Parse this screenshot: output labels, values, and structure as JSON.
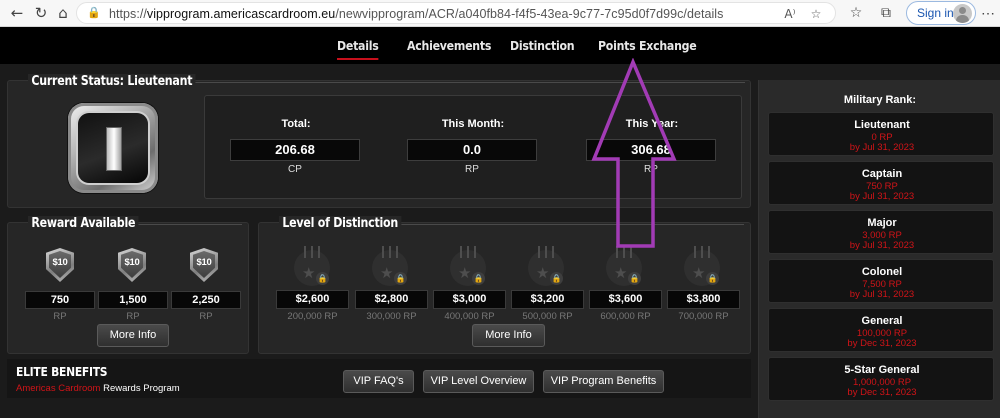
{
  "browser": {
    "url_prefix": "https://",
    "url_host": "vipprogram.americascardroom.eu",
    "url_path": "/newvipprogram/ACR/a040fb84-f4f5-43ea-9c77-7c95d0f7d99c/details",
    "signin_label": "Sign in",
    "icons": [
      "back-icon",
      "refresh-icon",
      "home-icon",
      "lock-icon",
      "read-aloud-icon",
      "favorite-icon",
      "favorites-bar-icon",
      "collections-icon",
      "profile-icon",
      "more-icon"
    ]
  },
  "nav": {
    "tabs": [
      {
        "label": "Details",
        "active": true
      },
      {
        "label": "Achievements",
        "active": false
      },
      {
        "label": "Distinction",
        "active": false
      },
      {
        "label": "Points Exchange",
        "active": false
      }
    ]
  },
  "status": {
    "title": "Current Status: Lieutenant",
    "stats": [
      {
        "label": "Total:",
        "value": "206.68",
        "unit": "CP"
      },
      {
        "label": "This Month:",
        "value": "0.0",
        "unit": "RP"
      },
      {
        "label": "This Year:",
        "value": "306.68",
        "unit": "RP"
      }
    ]
  },
  "reward": {
    "title": "Reward Available",
    "items": [
      {
        "badge": "$10",
        "value": "750",
        "unit": "RP"
      },
      {
        "badge": "$10",
        "value": "1,500",
        "unit": "RP"
      },
      {
        "badge": "$10",
        "value": "2,250",
        "unit": "RP"
      }
    ],
    "more_info": "More Info"
  },
  "distinction": {
    "title": "Level of Distinction",
    "items": [
      {
        "value": "$2,600",
        "rp": "200,000 RP"
      },
      {
        "value": "$2,800",
        "rp": "300,000 RP"
      },
      {
        "value": "$3,000",
        "rp": "400,000 RP"
      },
      {
        "value": "$3,200",
        "rp": "500,000 RP"
      },
      {
        "value": "$3,600",
        "rp": "600,000 RP"
      },
      {
        "value": "$3,800",
        "rp": "700,000 RP"
      }
    ],
    "more_info": "More Info"
  },
  "elite": {
    "title": "ELITE BENEFITS",
    "sub_red": "Americas Cardroom",
    "sub_white": " Rewards Program",
    "buttons": [
      "VIP FAQ's",
      "VIP Level Overview",
      "VIP Program Benefits"
    ]
  },
  "military": {
    "heading": "Military Rank:",
    "ranks": [
      {
        "name": "Lieutenant",
        "rp": "0 RP",
        "by": "by Jul 31, 2023"
      },
      {
        "name": "Captain",
        "rp": "750 RP",
        "by": "by Jul 31, 2023"
      },
      {
        "name": "Major",
        "rp": "3,000 RP",
        "by": "by Jul 31, 2023"
      },
      {
        "name": "Colonel",
        "rp": "7,500 RP",
        "by": "by Jul 31, 2023"
      },
      {
        "name": "General",
        "rp": "100,000 RP",
        "by": "by Dec 31, 2023"
      },
      {
        "name": "5-Star General",
        "rp": "1,000,000 RP",
        "by": "by Dec 31, 2023"
      }
    ]
  },
  "annotation": {
    "color": "#a23bb5",
    "shape": "up-arrow"
  }
}
